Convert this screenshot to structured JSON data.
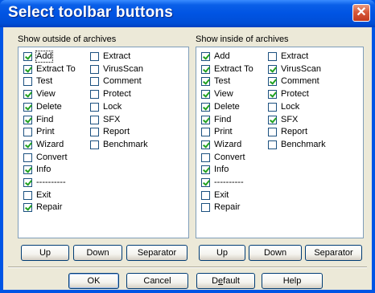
{
  "window": {
    "title": "Select toolbar buttons"
  },
  "left": {
    "label": "Show outside of archives",
    "col1": [
      {
        "text": "Add",
        "checked": true
      },
      {
        "text": "Extract To",
        "checked": true
      },
      {
        "text": "Test",
        "checked": false
      },
      {
        "text": "View",
        "checked": true
      },
      {
        "text": "Delete",
        "checked": true
      },
      {
        "text": "Find",
        "checked": true
      },
      {
        "text": "Print",
        "checked": false
      },
      {
        "text": "Wizard",
        "checked": true
      },
      {
        "text": "Convert",
        "checked": false
      },
      {
        "text": "Info",
        "checked": true
      },
      {
        "text": "----------",
        "checked": true
      },
      {
        "text": "Exit",
        "checked": false
      },
      {
        "text": "Repair",
        "checked": true
      }
    ],
    "col2": [
      {
        "text": "Extract",
        "checked": false
      },
      {
        "text": "VirusScan",
        "checked": false
      },
      {
        "text": "Comment",
        "checked": false
      },
      {
        "text": "Protect",
        "checked": false
      },
      {
        "text": "Lock",
        "checked": false
      },
      {
        "text": "SFX",
        "checked": false
      },
      {
        "text": "Report",
        "checked": false
      },
      {
        "text": "Benchmark",
        "checked": false
      }
    ],
    "buttons": {
      "up": "Up",
      "down": "Down",
      "separator": "Separator"
    }
  },
  "right": {
    "label": "Show inside of archives",
    "col1": [
      {
        "text": "Add",
        "checked": true
      },
      {
        "text": "Extract To",
        "checked": true
      },
      {
        "text": "Test",
        "checked": true
      },
      {
        "text": "View",
        "checked": true
      },
      {
        "text": "Delete",
        "checked": true
      },
      {
        "text": "Find",
        "checked": true
      },
      {
        "text": "Print",
        "checked": false
      },
      {
        "text": "Wizard",
        "checked": true
      },
      {
        "text": "Convert",
        "checked": false
      },
      {
        "text": "Info",
        "checked": true
      },
      {
        "text": "----------",
        "checked": true
      },
      {
        "text": "Exit",
        "checked": false
      },
      {
        "text": "Repair",
        "checked": false
      }
    ],
    "col2": [
      {
        "text": "Extract",
        "checked": false
      },
      {
        "text": "VirusScan",
        "checked": true
      },
      {
        "text": "Comment",
        "checked": true
      },
      {
        "text": "Protect",
        "checked": true
      },
      {
        "text": "Lock",
        "checked": false
      },
      {
        "text": "SFX",
        "checked": true
      },
      {
        "text": "Report",
        "checked": false
      },
      {
        "text": "Benchmark",
        "checked": false
      }
    ],
    "buttons": {
      "up": "Up",
      "down": "Down",
      "separator": "Separator"
    }
  },
  "footer": {
    "ok": "OK",
    "cancel": "Cancel",
    "default_pre": "D",
    "default_ul": "e",
    "default_post": "fault",
    "help": "Help"
  }
}
